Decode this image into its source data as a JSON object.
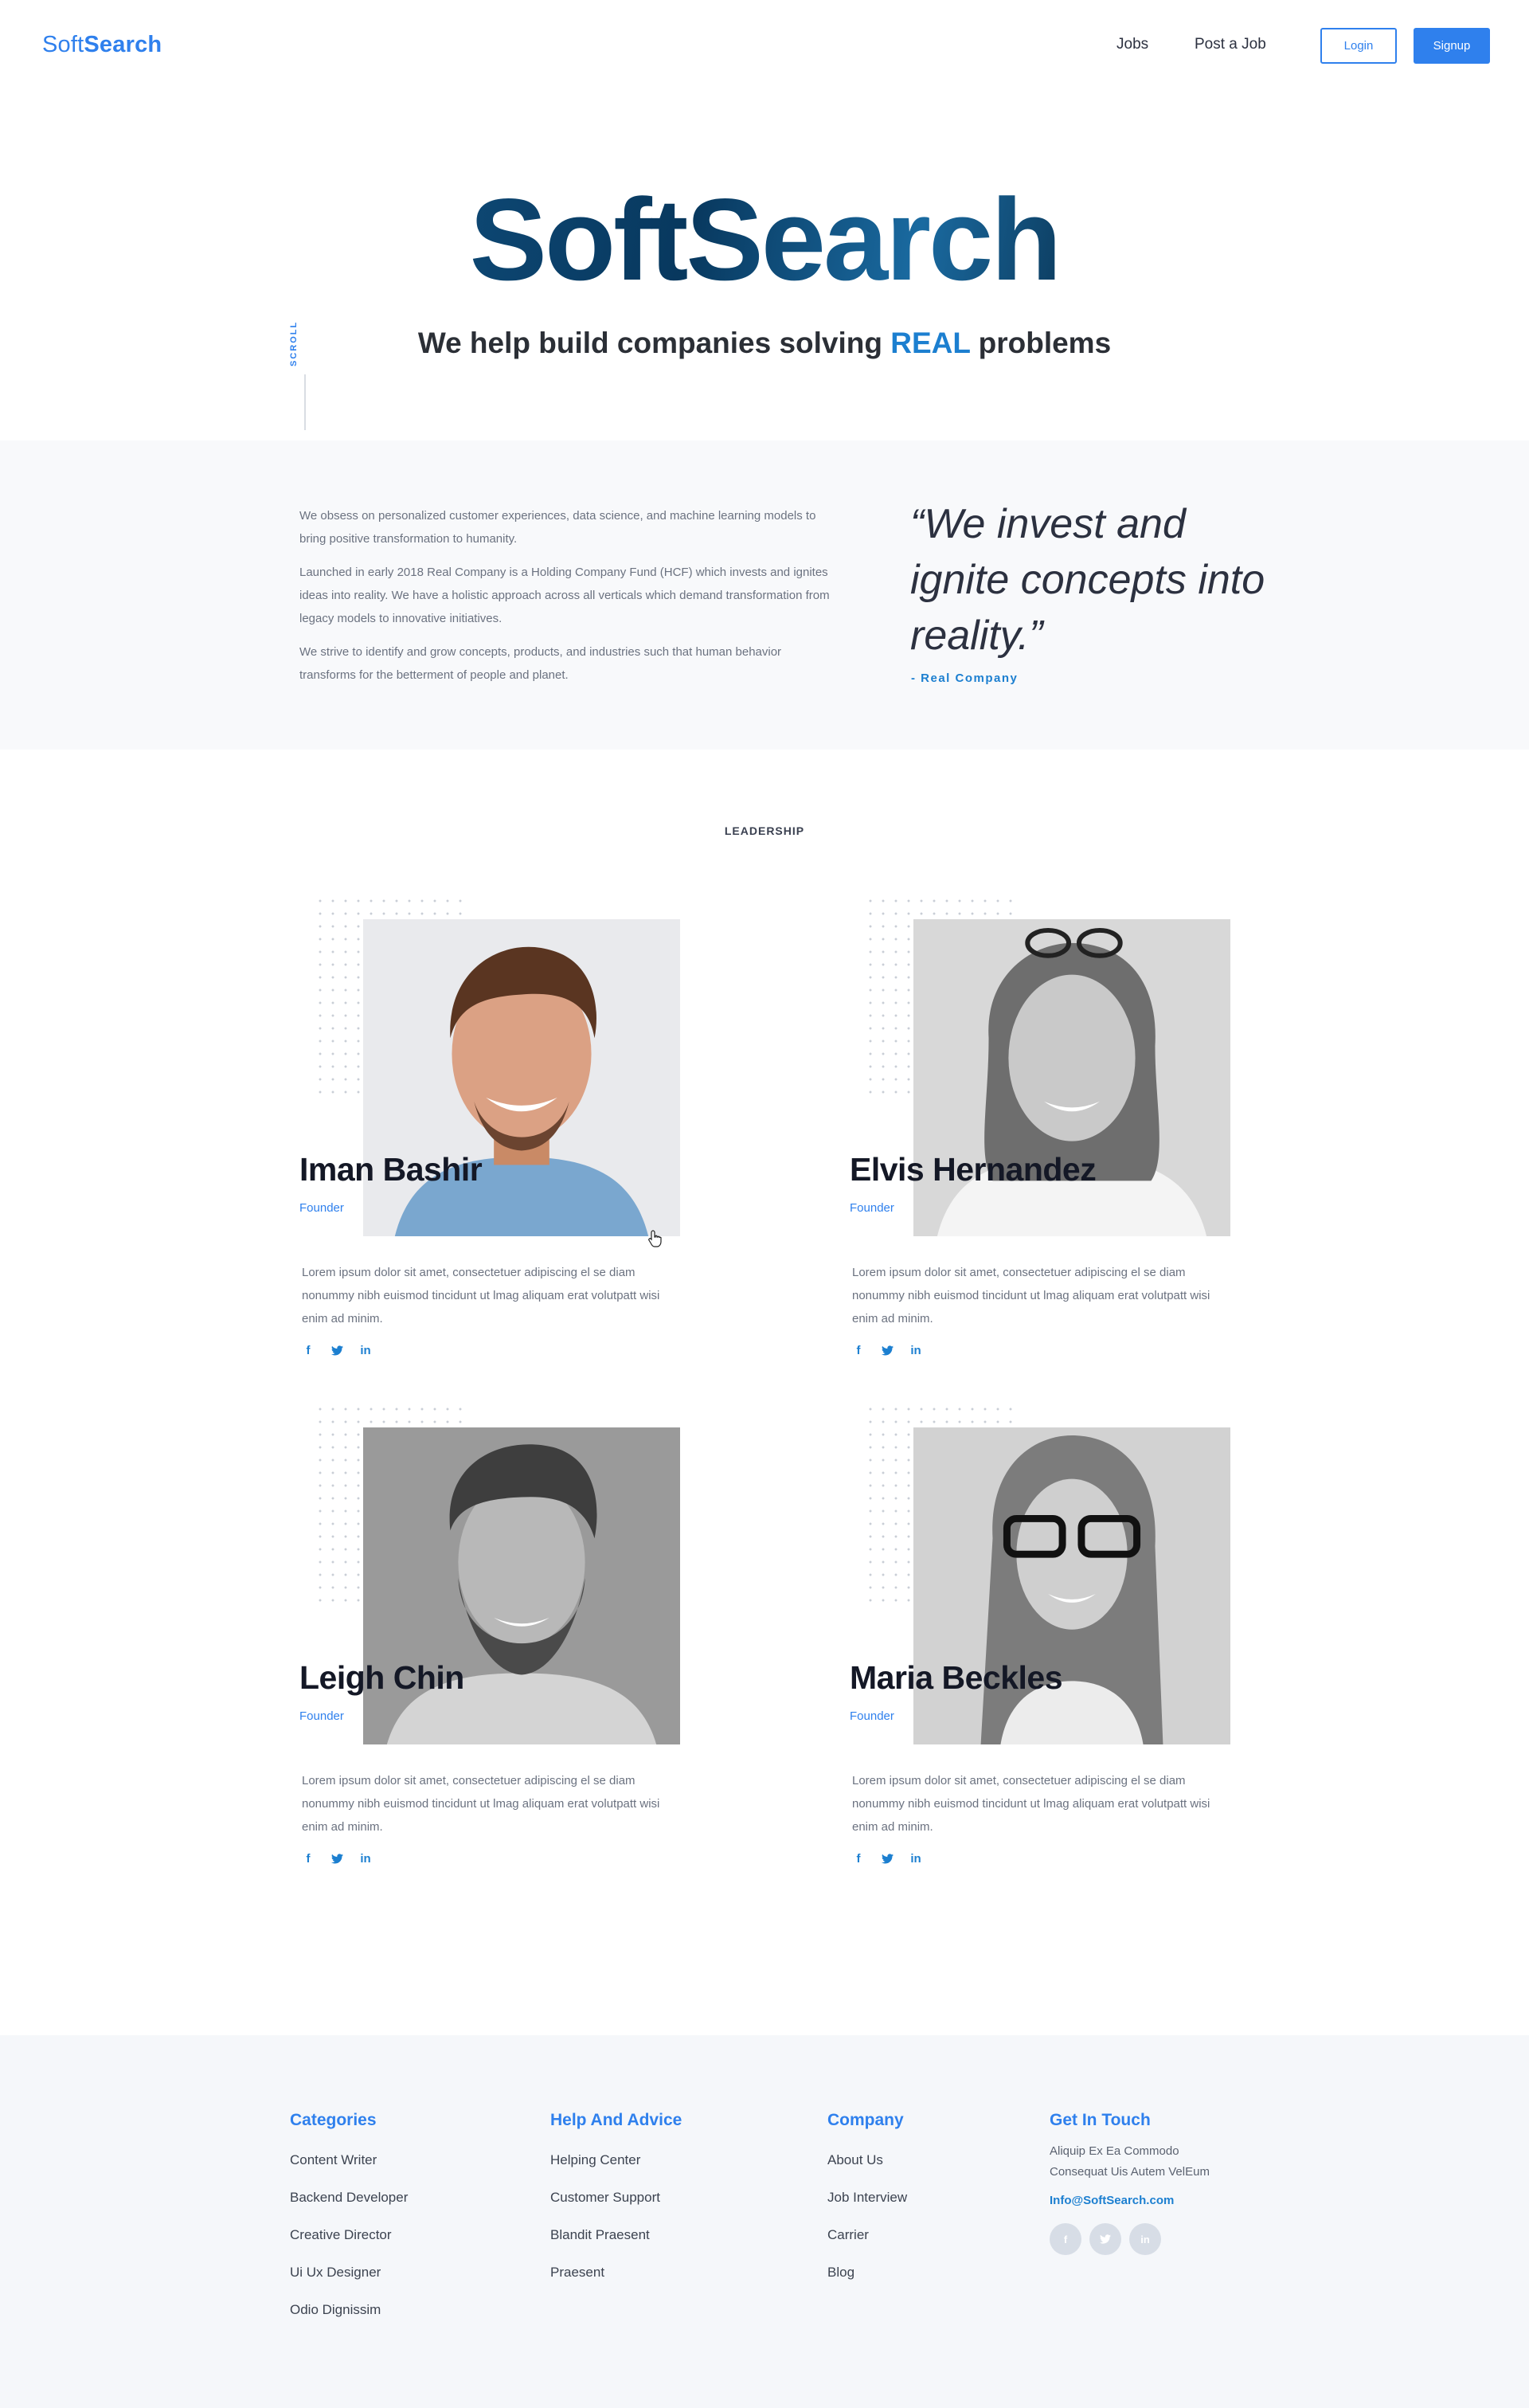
{
  "header": {
    "logo_part1": "Soft",
    "logo_part2": "Search",
    "nav": {
      "jobs": "Jobs",
      "post_job": "Post a Job"
    },
    "login": "Login",
    "signup": "Signup"
  },
  "hero": {
    "title": "SoftSearch",
    "subtitle_before": "We help build companies solving ",
    "subtitle_highlight": "REAL",
    "subtitle_after": " problems",
    "scroll": "SCROLL"
  },
  "about": {
    "paragraphs": [
      "We obsess on personalized customer experiences, data science, and machine learning models to bring positive transformation to humanity.",
      "Launched in early 2018 Real Company is a Holding Company Fund (HCF) which invests and ignites ideas into reality.  We have a holistic approach across all verticals which demand transformation from legacy models to innovative initiatives.",
      "We strive to identify and grow concepts, products, and industries such that human behavior transforms for the betterment of people and planet."
    ],
    "quote": "“We invest and ignite concepts into reality.”",
    "quote_author": "- Real Company"
  },
  "leadership": {
    "title": "LEADERSHIP",
    "members": [
      {
        "name": "Iman Bashir",
        "role": "Founder",
        "bio": "Lorem ipsum dolor sit amet, consectetuer adipiscing el se diam nonummy nibh euismod tincidunt ut lmag aliquam erat volutpatt wisi enim ad minim."
      },
      {
        "name": "Elvis Hernandez",
        "role": "Founder",
        "bio": "Lorem ipsum dolor sit amet, consectetuer adipiscing el se diam nonummy nibh euismod tincidunt ut lmag aliquam erat volutpatt wisi enim ad minim."
      },
      {
        "name": "Leigh Chin",
        "role": "Founder",
        "bio": "Lorem ipsum dolor sit amet, consectetuer adipiscing el se diam nonummy nibh euismod tincidunt ut lmag aliquam erat volutpatt wisi enim ad minim."
      },
      {
        "name": "Maria Beckles",
        "role": "Founder",
        "bio": "Lorem ipsum dolor sit amet, consectetuer adipiscing el se diam nonummy nibh euismod tincidunt ut lmag aliquam erat volutpatt wisi enim ad minim."
      }
    ],
    "social_icons": [
      "facebook-icon",
      "twitter-icon",
      "linkedin-icon"
    ]
  },
  "footer": {
    "categories": {
      "title": "Categories",
      "items": [
        "Content Writer",
        "Backend Developer",
        "Creative Director",
        "Ui Ux Designer",
        "Odio Dignissim"
      ]
    },
    "help": {
      "title": "Help And Advice",
      "items": [
        "Helping Center",
        "Customer Support",
        "Blandit Praesent",
        "Praesent"
      ]
    },
    "company": {
      "title": "Company",
      "items": [
        "About Us",
        "Job Interview",
        "Carrier",
        "Blog"
      ]
    },
    "contact": {
      "title": "Get In Touch",
      "address_line1": "Aliquip Ex Ea Commodo",
      "address_line2": "Consequat Uis Autem VelEum",
      "email": "Info@SoftSearch.com"
    }
  },
  "colors": {
    "accent": "#2f80ed",
    "highlight": "#1c7fd0",
    "section_bg": "#f8f9fb",
    "footer_bg": "#f5f7fa"
  }
}
